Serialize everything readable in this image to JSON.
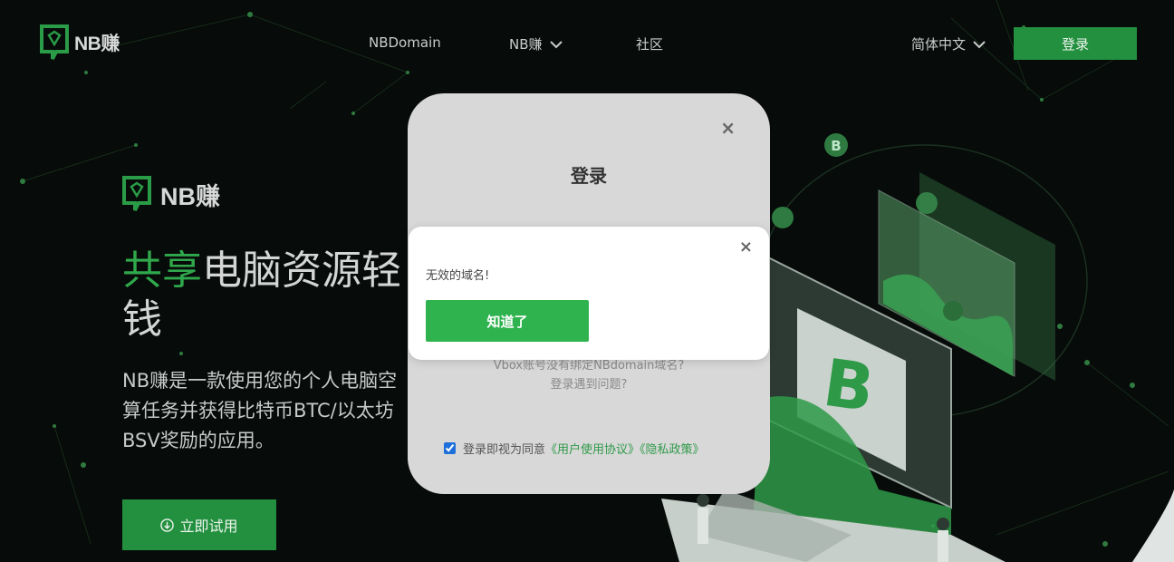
{
  "header": {
    "logo_text": "NB赚",
    "nav": {
      "nbdomain": "NBDomain",
      "nbzhuan": "NB赚",
      "community": "社区"
    },
    "language": "简体中文",
    "login_button": "登录"
  },
  "hero": {
    "logo_text": "NB赚",
    "headline_accent": "共享",
    "headline_rest": "电脑资源轻",
    "headline_line2": "钱",
    "description": "NB赚是一款使用您的个人电脑空算任务并获得比特币BTC/以太坊BSV奖励的应用。",
    "try_button": "立即试用"
  },
  "login_modal": {
    "title": "登录",
    "close": "×",
    "link1": "Vbox账号没有绑定NBdomain域名?",
    "link2": "登录遇到问题?",
    "agree_prefix": "登录即视为同意",
    "terms_link": "《用户使用协议》",
    "privacy_link": "《隐私政策》",
    "agree_checked": true
  },
  "alert": {
    "message": "无效的域名!",
    "button": "知道了",
    "close": "×"
  },
  "colors": {
    "accent_green": "#23903f",
    "alert_button": "#2fb34f",
    "background": "#070b09"
  }
}
